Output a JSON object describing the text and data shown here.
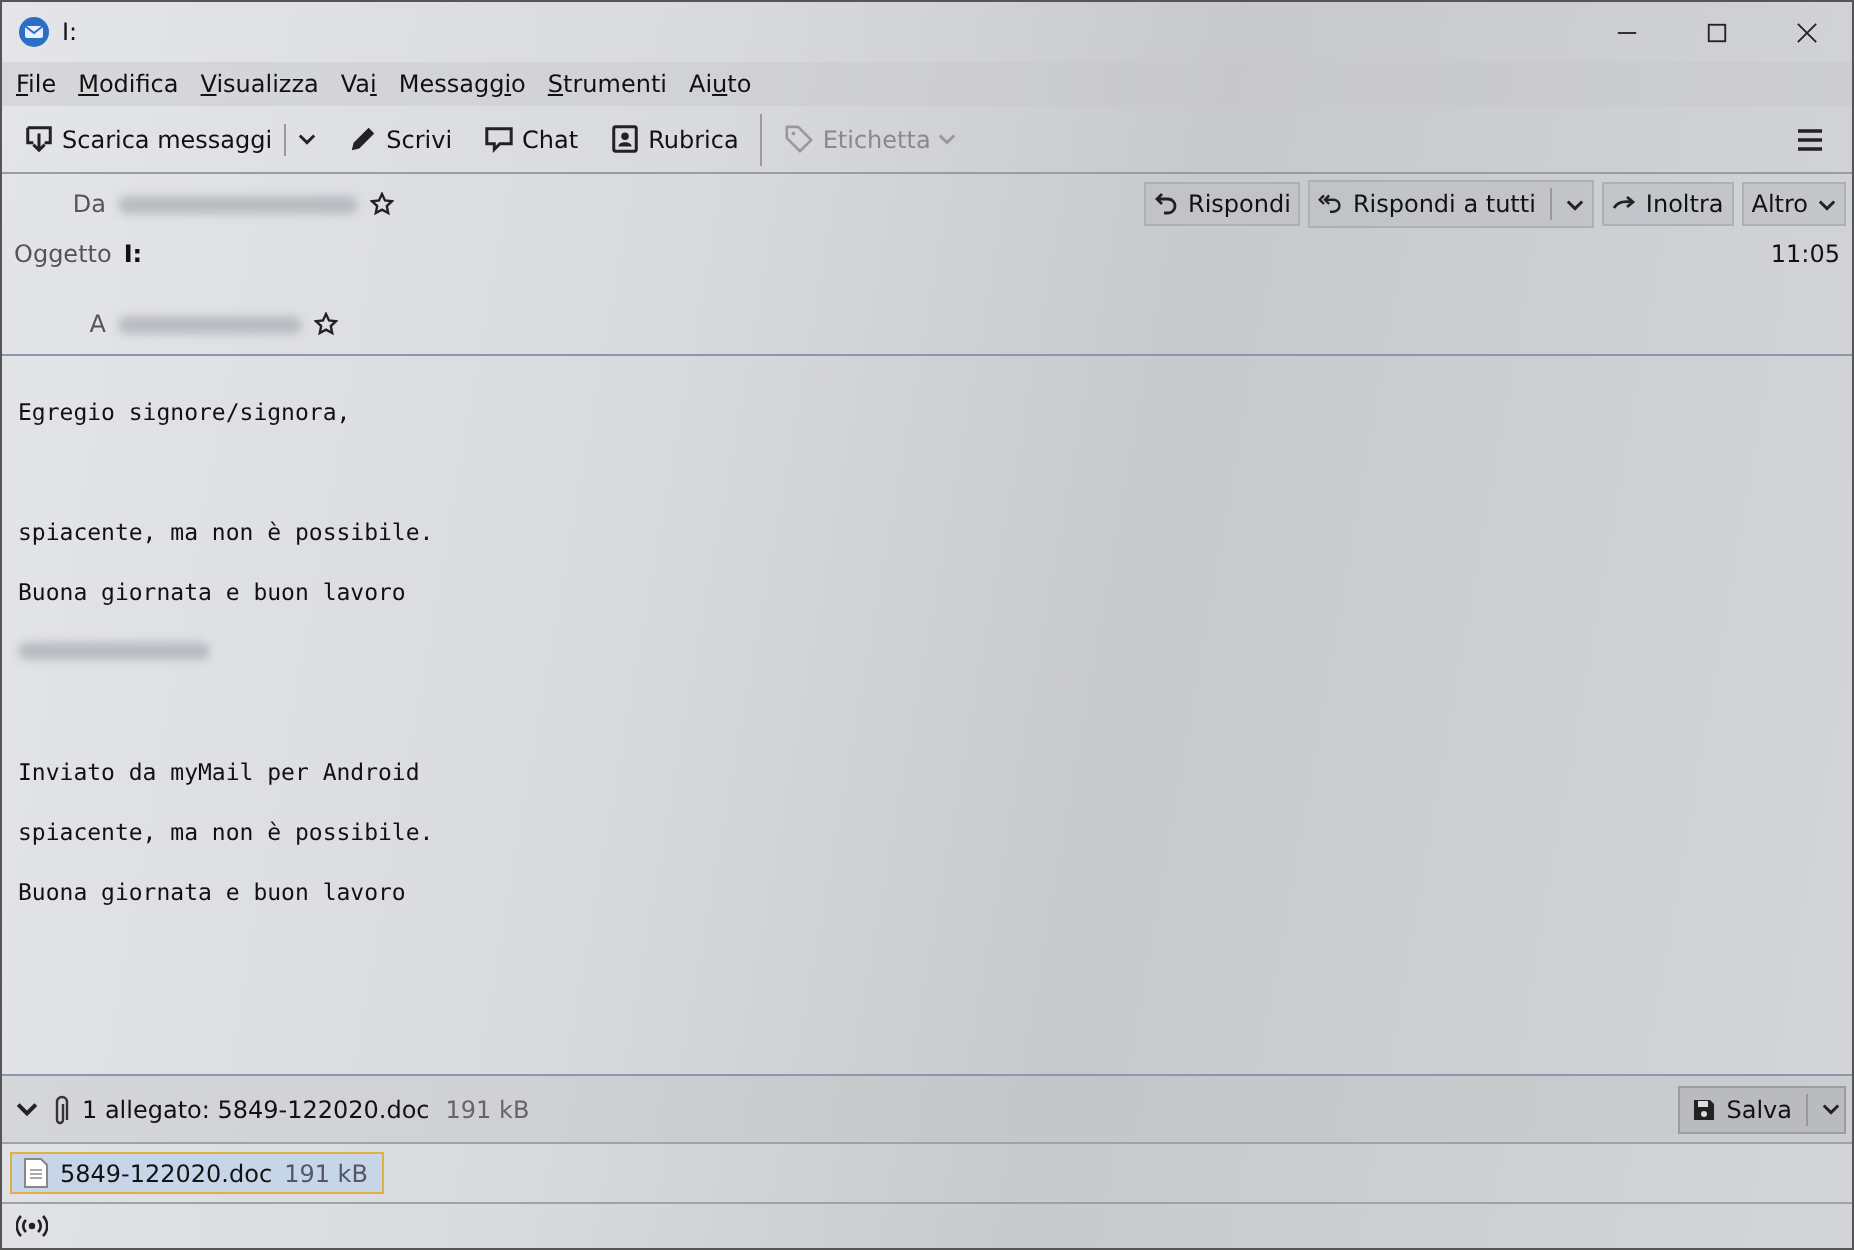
{
  "window": {
    "title": "I:"
  },
  "menu": [
    {
      "key": "F",
      "after": "ile"
    },
    {
      "key": "M",
      "after": "odifica"
    },
    {
      "key": "V",
      "after": "isualizza"
    },
    {
      "before": "Va",
      "key": "i"
    },
    {
      "before": "Messagg",
      "key": "i",
      "after": "o"
    },
    {
      "key": "S",
      "after": "trumenti"
    },
    {
      "before": "Ai",
      "key": "u",
      "after": "to"
    }
  ],
  "toolbar": [
    {
      "kind": "download",
      "label": "Scarica messaggi",
      "dropdown": true,
      "disabled": false
    },
    {
      "kind": "write",
      "label": "Scrivi",
      "dropdown": false,
      "disabled": false
    },
    {
      "kind": "chat",
      "label": "Chat",
      "dropdown": false,
      "disabled": false
    },
    {
      "kind": "contacts",
      "label": "Rubrica",
      "dropdown": false,
      "disabled": false
    },
    {
      "kind": "tag",
      "label": "Etichetta",
      "dropdown": true,
      "disabled": true
    }
  ],
  "header": {
    "from_label": "Da",
    "subject_label": "Oggetto",
    "subject": "I:",
    "time": "11:05",
    "to_label": "A",
    "actions": [
      {
        "kind": "reply",
        "label": "Rispondi",
        "dropdown": false
      },
      {
        "kind": "reply-all",
        "label": "Rispondi a tutti",
        "dropdown": true
      },
      {
        "kind": "forward",
        "label": "Inoltra",
        "dropdown": false
      },
      {
        "kind": "more",
        "label": "Altro",
        "dropdown": true
      }
    ]
  },
  "body": [
    {
      "kind": "text",
      "text": "Egregio signore/signora,"
    },
    {
      "kind": "blank"
    },
    {
      "kind": "text",
      "text": "spiacente, ma non è possibile."
    },
    {
      "kind": "text",
      "text": "Buona giornata e buon lavoro"
    },
    {
      "kind": "redacted"
    },
    {
      "kind": "blank"
    },
    {
      "kind": "text",
      "text": "Inviato da myMail per Android"
    },
    {
      "kind": "text",
      "text": "spiacente, ma non è possibile."
    },
    {
      "kind": "text",
      "text": "Buona giornata e buon lavoro"
    }
  ],
  "attachment_bar": {
    "summary": "1 allegato: 5849-122020.doc",
    "size": "191 kB",
    "save_label": "Salva"
  },
  "attachments": [
    {
      "name": "5849-122020.doc",
      "size": "191 kB",
      "selected": true
    }
  ]
}
